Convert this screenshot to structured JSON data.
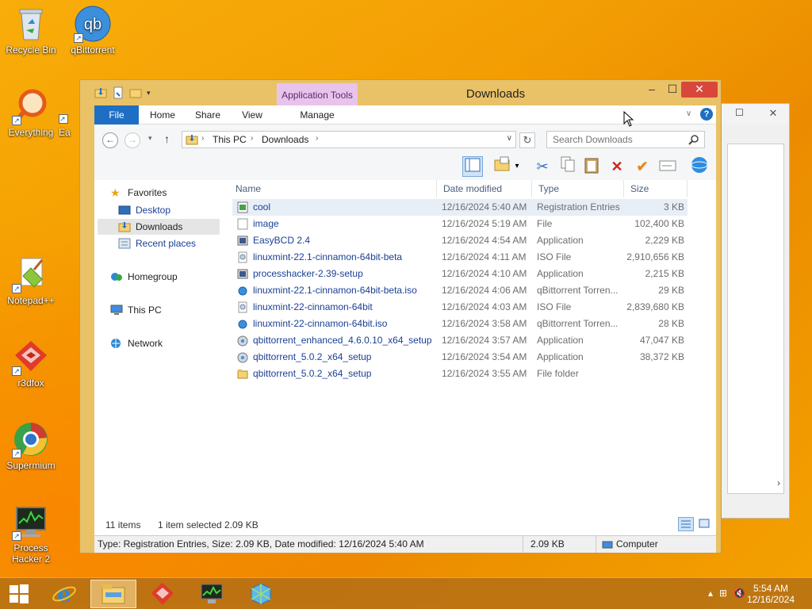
{
  "desktop": {
    "icons": [
      {
        "label": "Recycle Bin",
        "icon": "recycle-bin-icon"
      },
      {
        "label": "qBittorrent",
        "icon": "qbittorrent-icon"
      },
      {
        "label": "Everything",
        "icon": "everything-icon"
      },
      {
        "label": "Ea",
        "icon": "shortcut-icon"
      },
      {
        "label": "Notepad++",
        "icon": "notepad-plus-plus-icon"
      },
      {
        "label": "r3dfox",
        "icon": "r3dfox-icon"
      },
      {
        "label": "Supermium",
        "icon": "supermium-icon"
      },
      {
        "label": "Process Hacker 2",
        "icon": "process-hacker-icon"
      }
    ]
  },
  "window": {
    "title": "Downloads",
    "context_tab": "Application Tools",
    "ribbon_tabs": [
      "File",
      "Home",
      "Share",
      "View",
      "Manage"
    ],
    "minimize": "–",
    "maximize": "☐",
    "close": "✕"
  },
  "address": {
    "segments": [
      "This PC",
      "Downloads"
    ],
    "search_placeholder": "Search Downloads"
  },
  "nav": {
    "favorites": "Favorites",
    "desktop": "Desktop",
    "downloads": "Downloads",
    "recent": "Recent places",
    "homegroup": "Homegroup",
    "this_pc": "This PC",
    "network": "Network"
  },
  "columns": {
    "name": "Name",
    "date": "Date modified",
    "type": "Type",
    "size": "Size"
  },
  "files": [
    {
      "name": "cool",
      "date": "12/16/2024 5:40 AM",
      "type": "Registration Entries",
      "size": "3 KB",
      "icon": "registry-icon"
    },
    {
      "name": "image",
      "date": "12/16/2024 5:19 AM",
      "type": "File",
      "size": "102,400 KB",
      "icon": "file-icon"
    },
    {
      "name": "EasyBCD 2.4",
      "date": "12/16/2024 4:54 AM",
      "type": "Application",
      "size": "2,229 KB",
      "icon": "application-icon"
    },
    {
      "name": "linuxmint-22.1-cinnamon-64bit-beta",
      "date": "12/16/2024 4:11 AM",
      "type": "ISO File",
      "size": "2,910,656 KB",
      "icon": "iso-icon"
    },
    {
      "name": "processhacker-2.39-setup",
      "date": "12/16/2024 4:10 AM",
      "type": "Application",
      "size": "2,215 KB",
      "icon": "application-icon"
    },
    {
      "name": "linuxmint-22.1-cinnamon-64bit-beta.iso",
      "date": "12/16/2024 4:06 AM",
      "type": "qBittorrent Torren...",
      "size": "29 KB",
      "icon": "torrent-icon"
    },
    {
      "name": "linuxmint-22-cinnamon-64bit",
      "date": "12/16/2024 4:03 AM",
      "type": "ISO File",
      "size": "2,839,680 KB",
      "icon": "iso-icon"
    },
    {
      "name": "linuxmint-22-cinnamon-64bit.iso",
      "date": "12/16/2024 3:58 AM",
      "type": "qBittorrent Torren...",
      "size": "28 KB",
      "icon": "torrent-icon"
    },
    {
      "name": "qbittorrent_enhanced_4.6.0.10_x64_setup",
      "date": "12/16/2024 3:57 AM",
      "type": "Application",
      "size": "47,047 KB",
      "icon": "installer-icon"
    },
    {
      "name": "qbittorrent_5.0.2_x64_setup",
      "date": "12/16/2024 3:54 AM",
      "type": "Application",
      "size": "38,372 KB",
      "icon": "installer-icon"
    },
    {
      "name": "qbittorrent_5.0.2_x64_setup",
      "date": "12/16/2024 3:55 AM",
      "type": "File folder",
      "size": "",
      "icon": "folder-icon"
    }
  ],
  "status": {
    "items": "11 items",
    "selected": "1 item selected",
    "selected_size": "2.09 KB",
    "details": "Type: Registration Entries, Size: 2.09 KB, Date modified: 12/16/2024 5:40 AM",
    "details_size": "2.09 KB",
    "location": "Computer"
  },
  "taskbar": {
    "time": "5:54 AM",
    "date": "12/16/2024"
  },
  "colors": {
    "accent": "#1e6fc4",
    "close": "#d9473b",
    "frame": "#e9c167",
    "context_tab": "#e8c4ec"
  }
}
